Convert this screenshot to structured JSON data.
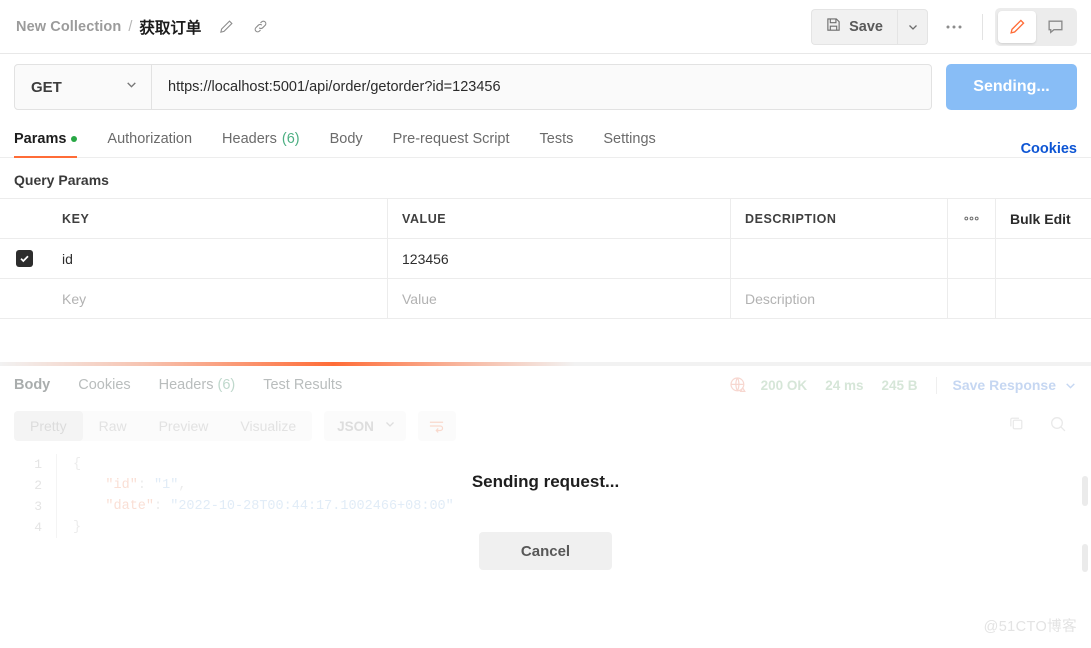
{
  "header": {
    "collection": "New Collection",
    "separator": "/",
    "request_name": "获取订单",
    "edit_icon": "pencil-icon",
    "share_icon": "link-icon",
    "save_label": "Save",
    "save_icon": "floppy-disk-icon",
    "save_caret_icon": "chevron-down-icon",
    "more_icon": "ellipsis-icon",
    "pen_icon": "pencil-icon",
    "comment_icon": "comment-icon",
    "accent_color": "#ff6c37"
  },
  "request": {
    "method": "GET",
    "method_caret_icon": "chevron-down-icon",
    "url": "https://localhost:5001/api/order/getorder?id=123456",
    "url_placeholder": "Enter request URL",
    "send_label": "Sending...",
    "send_color": "#88bdf6"
  },
  "request_tabs": {
    "items": [
      {
        "label": "Params",
        "dot": true,
        "active": true
      },
      {
        "label": "Authorization",
        "active": false
      },
      {
        "label": "Headers",
        "count": "(6)",
        "active": false
      },
      {
        "label": "Body",
        "active": false
      },
      {
        "label": "Pre-request Script",
        "active": false
      },
      {
        "label": "Tests",
        "active": false
      },
      {
        "label": "Settings",
        "active": false
      }
    ],
    "cookies_label": "Cookies",
    "cookies_color": "#0d55d4"
  },
  "query_params": {
    "title": "Query Params",
    "columns": [
      "KEY",
      "VALUE",
      "DESCRIPTION"
    ],
    "menu_icon": "ellipsis-icon",
    "bulk_edit_label": "Bulk Edit",
    "rows": [
      {
        "checked": true,
        "key": "id",
        "value": "123456",
        "description": ""
      }
    ],
    "placeholder_row": {
      "key": "Key",
      "value": "Value",
      "description": "Description"
    }
  },
  "response": {
    "progress_color": "#ff6c37",
    "tabs": [
      {
        "label": "Body",
        "active": true
      },
      {
        "label": "Cookies",
        "active": false
      },
      {
        "label": "Headers",
        "count": "(6)",
        "active": false
      },
      {
        "label": "Test Results",
        "active": false
      }
    ],
    "status_icon": "globe-warning-icon",
    "status": "200 OK",
    "time": "24 ms",
    "size": "245 B",
    "save_response_label": "Save Response",
    "save_response_caret_icon": "chevron-down-icon",
    "view_tabs": [
      {
        "label": "Pretty",
        "active": true
      },
      {
        "label": "Raw",
        "active": false
      },
      {
        "label": "Preview",
        "active": false
      },
      {
        "label": "Visualize",
        "active": false
      }
    ],
    "format": "JSON",
    "format_caret_icon": "chevron-down-icon",
    "wrap_icon": "word-wrap-icon",
    "copy_icon": "copy-icon",
    "search_icon": "search-icon",
    "body_lines": [
      {
        "num": "1",
        "parts": [
          {
            "t": "punct",
            "s": "{"
          }
        ]
      },
      {
        "num": "2",
        "parts": [
          {
            "t": "key",
            "s": "    \"id\""
          },
          {
            "t": "punct",
            "s": ": "
          },
          {
            "t": "str",
            "s": "\"1\""
          },
          {
            "t": "punct",
            "s": ","
          }
        ]
      },
      {
        "num": "3",
        "parts": [
          {
            "t": "key",
            "s": "    \"date\""
          },
          {
            "t": "punct",
            "s": ": "
          },
          {
            "t": "str",
            "s": "\"2022-10-28T00:44:17.1002466+08:00\""
          }
        ]
      },
      {
        "num": "4",
        "parts": [
          {
            "t": "punct",
            "s": "}"
          }
        ]
      }
    ],
    "overlay_text": "Sending request...",
    "cancel_label": "Cancel"
  },
  "watermark": "@51CTO博客"
}
